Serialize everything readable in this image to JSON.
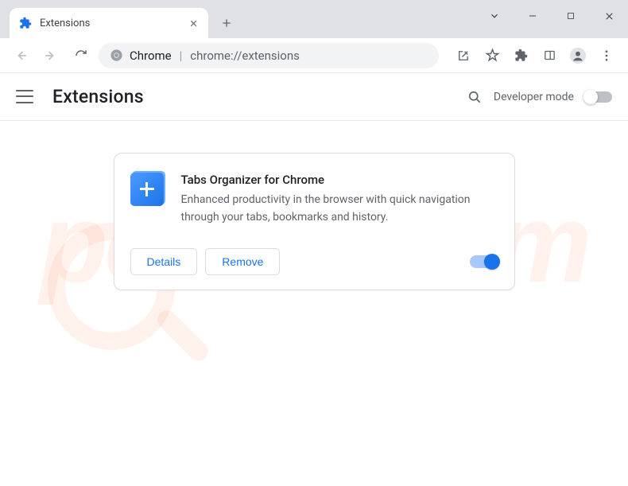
{
  "tab": {
    "title": "Extensions"
  },
  "omnibox": {
    "chrome_label": "Chrome",
    "url": "chrome://extensions"
  },
  "header": {
    "title": "Extensions",
    "dev_mode_label": "Developer mode",
    "dev_mode_on": false
  },
  "extension": {
    "name": "Tabs Organizer for Chrome",
    "description": "Enhanced productivity in the browser with quick navigation through your tabs, bookmarks and history.",
    "details_label": "Details",
    "remove_label": "Remove",
    "enabled": true
  },
  "watermark": "pcrisk.com"
}
